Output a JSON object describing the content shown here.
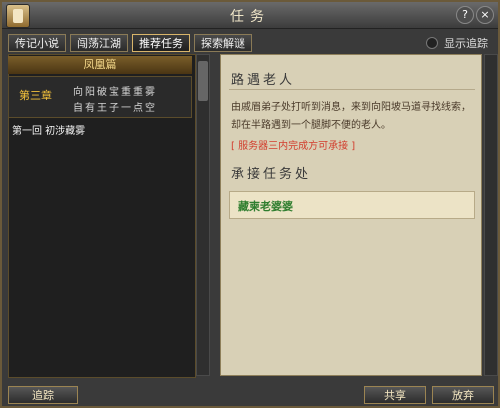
{
  "window": {
    "title": "任务"
  },
  "tabs": [
    {
      "label": "传记小说"
    },
    {
      "label": "闯荡江湖"
    },
    {
      "label": "推荐任务",
      "active": true
    },
    {
      "label": "探索解谜"
    }
  ],
  "toggle": {
    "label": "显示追踪"
  },
  "left": {
    "header": "凤凰篇",
    "chapter": {
      "number": "第三章",
      "line1": "向阳破宝重重雾",
      "line2": "自有王子一点空"
    },
    "quest_item": "第一回 初涉藏雾"
  },
  "right": {
    "title": "路遇老人",
    "description": "由戚眉弟子处打听到消息，来到向阳坡马道寻找线索，却在半路遇到一个腿脚不便的老人。",
    "warning": "[ 服务器三内完成方可承接 ]",
    "section_title": "承接任务处",
    "npc": "藏柬老婆婆"
  },
  "buttons": {
    "track": "追踪",
    "share": "共享",
    "abandon": "放弃"
  }
}
